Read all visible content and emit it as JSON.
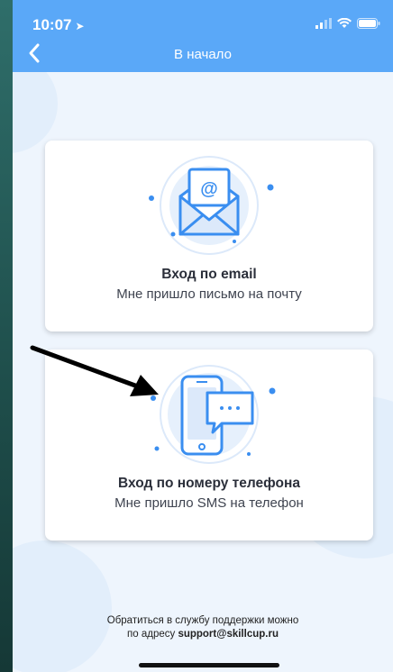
{
  "status_bar": {
    "time": "10:07",
    "location_glyph": "➤"
  },
  "nav": {
    "title": "В начало"
  },
  "cards": [
    {
      "title": "Вход по email",
      "subtitle": "Мне пришло письмо на почту",
      "icon": "envelope-icon"
    },
    {
      "title": "Вход по номеру телефона",
      "subtitle": "Мне пришло SMS на телефон",
      "icon": "phone-sms-icon"
    }
  ],
  "footer": {
    "line1": "Обратиться в службу поддержки можно",
    "line2_prefix": "по адресу ",
    "email": "support@skillcup.ru"
  },
  "colors": {
    "header": "#5aa8f8",
    "accent": "#3a8ef0",
    "background": "#eef5fd",
    "annotation_arrow": "#000000"
  }
}
